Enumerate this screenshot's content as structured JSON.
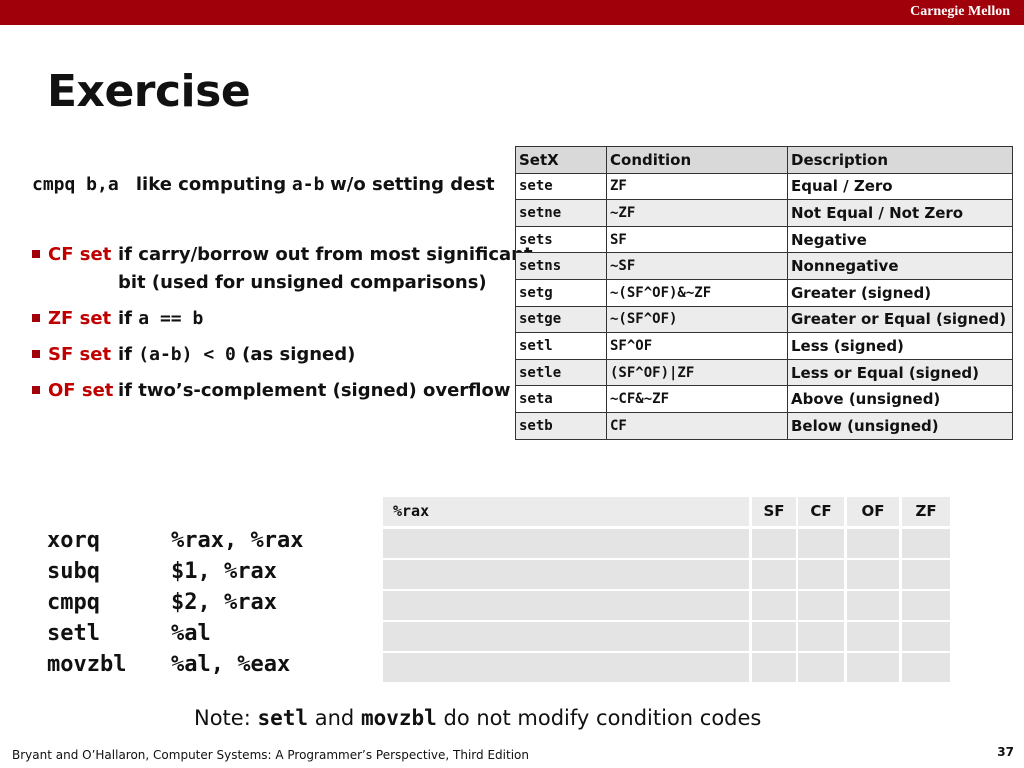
{
  "header": {
    "brand": "Carnegie Mellon"
  },
  "title": "Exercise",
  "intro": {
    "code": "cmpq b,a",
    "text1": "like computing",
    "code2": "a-b",
    "text2": "w/o setting dest"
  },
  "flags": [
    {
      "name": "CF set",
      "desc": "if carry/borrow out from most significant",
      "desc2": "bit (used for unsigned comparisons)"
    },
    {
      "name": "ZF set",
      "prefix": "if",
      "code": "a == b"
    },
    {
      "name": "SF set",
      "prefix": "if",
      "code": "(a-b) < 0",
      "suffix": "(as signed)"
    },
    {
      "name": "OF set",
      "desc": "if two’s-complement (signed) overflow"
    }
  ],
  "setx_table": {
    "headers": [
      "SetX",
      "Condition",
      "Description"
    ],
    "rows": [
      [
        "sete",
        "ZF",
        "Equal / Zero"
      ],
      [
        "setne",
        "~ZF",
        "Not Equal / Not Zero"
      ],
      [
        "sets",
        "SF",
        "Negative"
      ],
      [
        "setns",
        "~SF",
        "Nonnegative"
      ],
      [
        "setg",
        "~(SF^OF)&~ZF",
        "Greater (signed)"
      ],
      [
        "setge",
        "~(SF^OF)",
        "Greater or Equal (signed)"
      ],
      [
        "setl",
        "SF^OF",
        "Less (signed)"
      ],
      [
        "setle",
        "(SF^OF)|ZF",
        "Less or Equal (signed)"
      ],
      [
        "seta",
        "~CF&~ZF",
        "Above (unsigned)"
      ],
      [
        "setb",
        "CF",
        "Below (unsigned)"
      ]
    ]
  },
  "assembly": [
    {
      "op": "xorq",
      "args": "%rax, %rax"
    },
    {
      "op": "subq",
      "args": "$1, %rax"
    },
    {
      "op": "cmpq",
      "args": "$2, %rax"
    },
    {
      "op": "setl",
      "args": "%al"
    },
    {
      "op": "movzbl",
      "args": "%al, %eax"
    }
  ],
  "exercise_grid": {
    "headers": [
      "%rax",
      "SF",
      "CF",
      "OF",
      "ZF"
    ],
    "rows": [
      [
        "",
        "",
        "",
        "",
        ""
      ],
      [
        "",
        "",
        "",
        "",
        ""
      ],
      [
        "",
        "",
        "",
        "",
        ""
      ],
      [
        "",
        "",
        "",
        "",
        ""
      ],
      [
        "",
        "",
        "",
        "",
        ""
      ]
    ]
  },
  "note": {
    "prefix": "Note:",
    "code1": "setl",
    "mid": "and",
    "code2": "movzbl",
    "suffix": "do not modify condition codes"
  },
  "footer": "Bryant and O’Hallaron, Computer Systems: A Programmer’s Perspective, Third Edition",
  "page_number": "37"
}
